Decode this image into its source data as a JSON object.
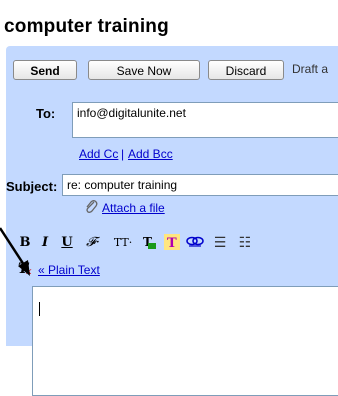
{
  "window": {
    "title": "computer training"
  },
  "buttons": {
    "send_label": "Send",
    "save_label": "Save Now",
    "discard_label": "Discard"
  },
  "draft_status": "Draft a",
  "to": {
    "label": "To:",
    "value": "info@digitalunite.net"
  },
  "cc_links": {
    "add_cc": "Add Cc",
    "separator": "|",
    "add_bcc": "Add Bcc"
  },
  "subject": {
    "label": "Subject:",
    "value": "re: computer training"
  },
  "attach": {
    "icon": "paperclip-icon",
    "label": "Attach a file"
  },
  "toolbar": {
    "bold": "B",
    "italic": "I",
    "underline": "U",
    "font": "𝓕·",
    "size": "TT·",
    "text_color": "T",
    "highlight": "T",
    "link": "⊝",
    "numbered_list": "☰",
    "bulleted_list": "☷"
  },
  "plain_text_link": "« Plain Text",
  "colors": {
    "panel_bg": "#c3d9ff",
    "link": "#0000cc"
  }
}
